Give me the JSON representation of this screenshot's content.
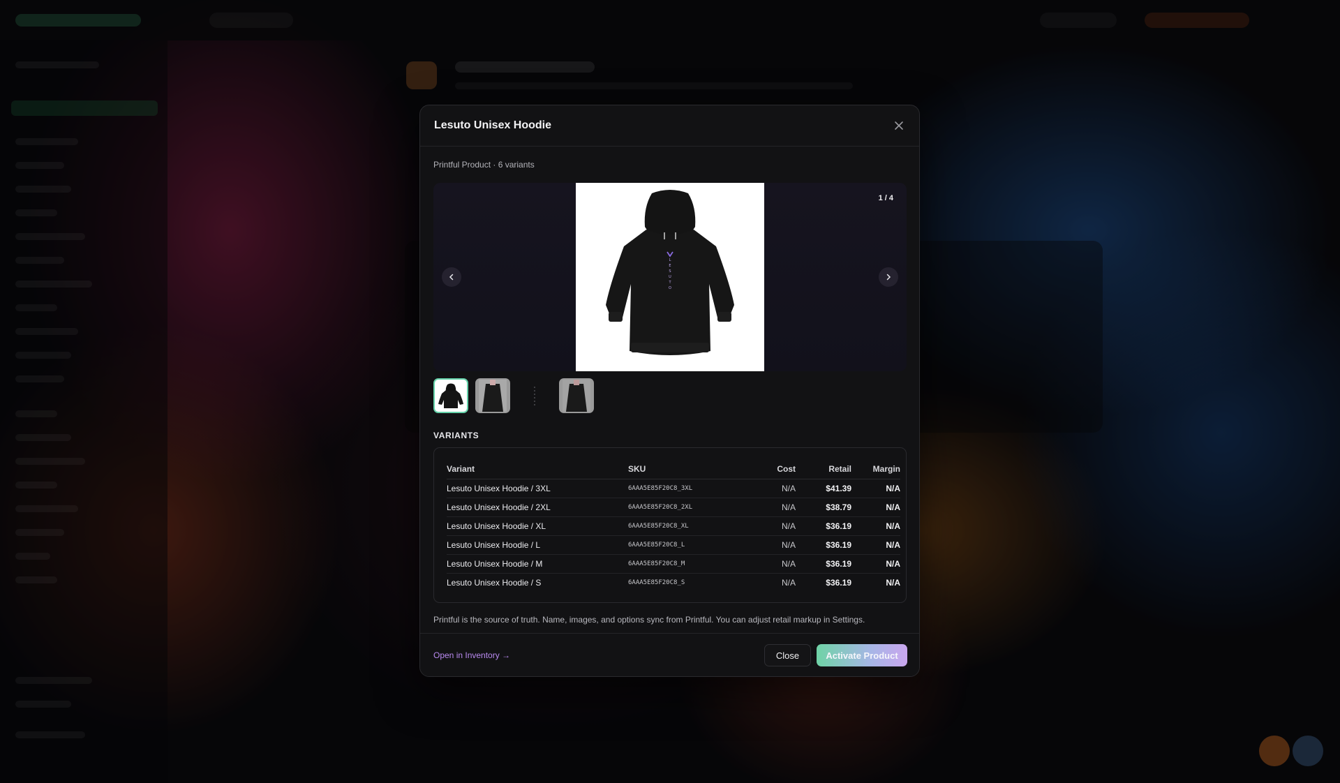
{
  "modal": {
    "title": "Lesuto Unisex Hoodie",
    "subtitle": "Printful Product · 6 variants",
    "gallery": {
      "counter": "1 / 4",
      "hoodie_print_text": "LESUTO",
      "thumbnails": [
        {
          "name": "thumb-1",
          "active": true
        },
        {
          "name": "thumb-2",
          "active": false
        },
        {
          "name": "thumb-3",
          "active": false
        },
        {
          "name": "thumb-4",
          "active": false
        }
      ]
    },
    "variants_label": "VARIANTS",
    "table": {
      "headers": {
        "variant": "Variant",
        "sku": "SKU",
        "cost": "Cost",
        "retail": "Retail",
        "margin": "Margin"
      },
      "rows": [
        {
          "variant": "Lesuto Unisex Hoodie / 3XL",
          "sku": "6AAA5E85F20C8_3XL",
          "cost": "N/A",
          "retail": "$41.39",
          "margin": "N/A"
        },
        {
          "variant": "Lesuto Unisex Hoodie / 2XL",
          "sku": "6AAA5E85F20C8_2XL",
          "cost": "N/A",
          "retail": "$38.79",
          "margin": "N/A"
        },
        {
          "variant": "Lesuto Unisex Hoodie / XL",
          "sku": "6AAA5E85F20C8_XL",
          "cost": "N/A",
          "retail": "$36.19",
          "margin": "N/A"
        },
        {
          "variant": "Lesuto Unisex Hoodie / L",
          "sku": "6AAA5E85F20C8_L",
          "cost": "N/A",
          "retail": "$36.19",
          "margin": "N/A"
        },
        {
          "variant": "Lesuto Unisex Hoodie / M",
          "sku": "6AAA5E85F20C8_M",
          "cost": "N/A",
          "retail": "$36.19",
          "margin": "N/A"
        },
        {
          "variant": "Lesuto Unisex Hoodie / S",
          "sku": "6AAA5E85F20C8_S",
          "cost": "N/A",
          "retail": "$36.19",
          "margin": "N/A"
        }
      ]
    },
    "footnote": "Printful is the source of truth. Name, images, and options sync from Printful. You can adjust retail markup in Settings.",
    "footer": {
      "open_link": "Open in Inventory →",
      "close_label": "Close",
      "activate_label": "Activate Product"
    }
  },
  "icons": {
    "close": "close-icon",
    "prev": "chevron-left-icon",
    "next": "chevron-right-icon"
  },
  "colors": {
    "accent_green": "#66d3ab",
    "accent_purple": "#c9a6ee",
    "link": "#b98af0"
  }
}
